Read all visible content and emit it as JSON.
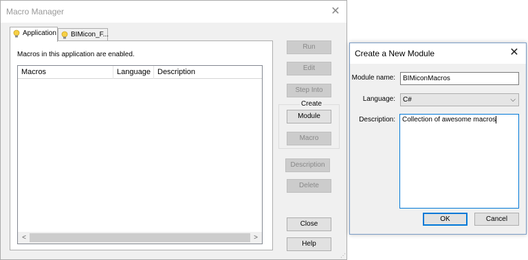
{
  "macro_manager": {
    "title": "Macro Manager",
    "tabs": [
      {
        "label": "Application",
        "icon": "lightbulb-icon",
        "active": true
      },
      {
        "label": "BIMicon_F...",
        "icon": "lightbulb-icon",
        "active": false
      }
    ],
    "status_message": "Macros in this application are enabled.",
    "list_columns": [
      "Macros",
      "Language",
      "Description"
    ],
    "buttons": {
      "run": "Run",
      "edit": "Edit",
      "step_into": "Step Into",
      "create_group": "Create",
      "module": "Module",
      "macro": "Macro",
      "description": "Description",
      "delete": "Delete",
      "close": "Close",
      "help": "Help"
    }
  },
  "new_module_dialog": {
    "title": "Create a New Module",
    "module_name_label": "Module name:",
    "module_name_value": "BIMiconMacros",
    "language_label": "Language:",
    "language_value": "C#",
    "description_label": "Description:",
    "description_value": "Collection of awesome macros",
    "ok_label": "OK",
    "cancel_label": "Cancel"
  },
  "colors": {
    "accent": "#0078d7",
    "window_bg": "#f0f0f0",
    "disabled_button": "#cccccc"
  }
}
